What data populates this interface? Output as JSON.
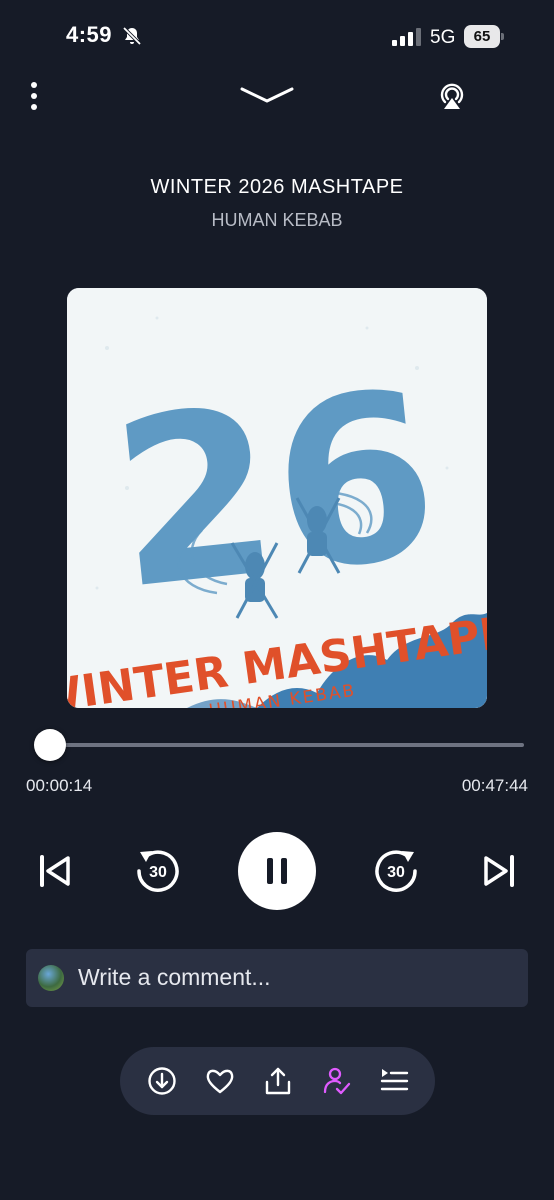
{
  "status_bar": {
    "time": "4:59",
    "network": "5G",
    "battery": "65",
    "icons": [
      "bell-muted-icon",
      "signal-icon"
    ]
  },
  "header": {
    "icons": [
      "more-vertical-icon",
      "chevron-down-icon",
      "airplay-icon"
    ]
  },
  "track": {
    "title": "WINTER 2026 MASHTAPE",
    "artist": "HUMAN KEBAB"
  },
  "artwork": {
    "big_text": "26",
    "album_title": "WINTER MASHTAPE",
    "album_artist": "HUMAN KEBAB",
    "colors": {
      "background": "#f2f6f7",
      "blue": "#5f9ac4",
      "orange": "#e0502a"
    }
  },
  "progress": {
    "elapsed": "00:00:14",
    "total": "00:47:44",
    "fraction": 0.005
  },
  "controls": {
    "rewind_seconds": "30",
    "forward_seconds": "30",
    "state": "playing",
    "icons": [
      "skip-previous-icon",
      "rewind-30-icon",
      "pause-icon",
      "forward-30-icon",
      "skip-next-icon"
    ]
  },
  "comment": {
    "placeholder": "Write a comment..."
  },
  "toolbar": {
    "items": [
      "download-icon",
      "heart-icon",
      "share-icon",
      "follow-icon",
      "queue-icon"
    ],
    "colors": {
      "follow": "#e05bff",
      "default": "#ffffff"
    }
  },
  "theme": {
    "background": "#161b27",
    "surface": "#2a3042"
  }
}
